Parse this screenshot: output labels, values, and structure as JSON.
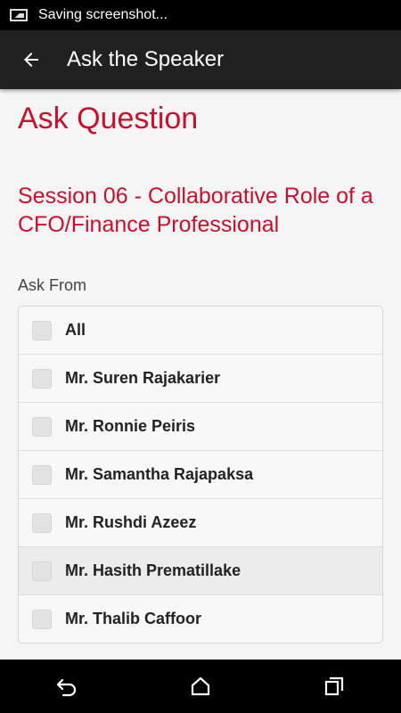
{
  "status_bar": {
    "text": "Saving screenshot..."
  },
  "app_bar": {
    "title": "Ask the Speaker"
  },
  "page": {
    "title": "Ask Question",
    "session_title": "Session 06 - Collaborative Role of a CFO/Finance Professional",
    "ask_from_label": "Ask From"
  },
  "speakers": [
    {
      "label": "All",
      "checked": false
    },
    {
      "label": "Mr. Suren Rajakarier",
      "checked": false
    },
    {
      "label": "Mr. Ronnie Peiris",
      "checked": false
    },
    {
      "label": "Mr. Samantha Rajapaksa",
      "checked": false
    },
    {
      "label": "Mr. Rushdi Azeez",
      "checked": false
    },
    {
      "label": "Mr. Hasith Prematillake",
      "checked": false
    },
    {
      "label": "Mr. Thalib Caffoor",
      "checked": false
    }
  ],
  "colors": {
    "accent": "#c8102e",
    "app_bar": "#212121",
    "background": "#f5f5f5"
  },
  "icons": {
    "back": "arrow-left",
    "nav_back": "back-arrow",
    "nav_home": "home",
    "nav_recents": "recents"
  }
}
